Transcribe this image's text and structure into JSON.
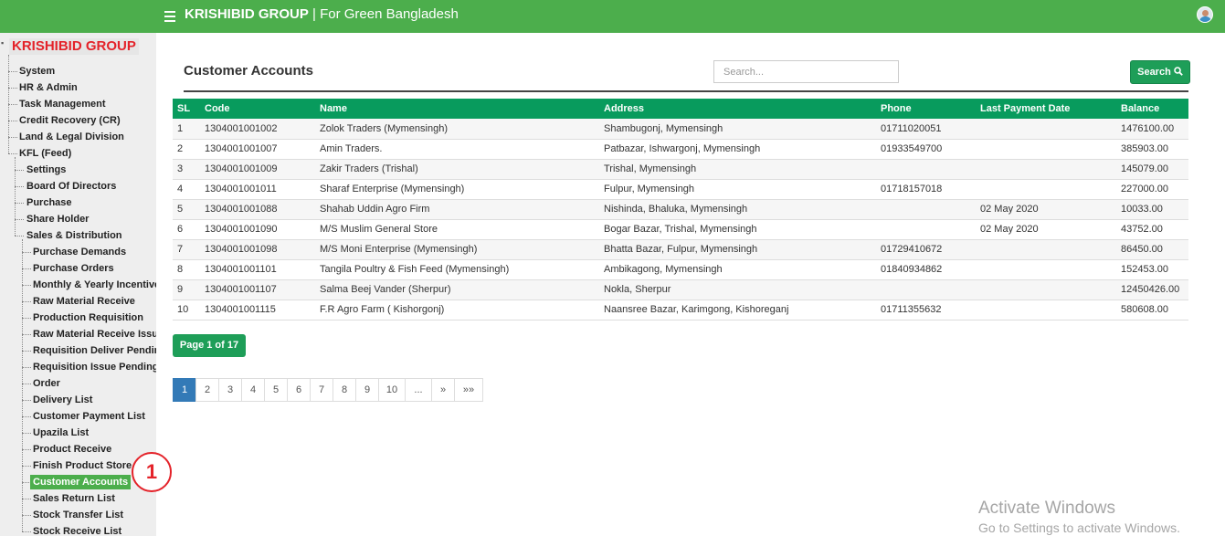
{
  "header": {
    "brand_strong": "KRISHIBID GROUP",
    "brand_rest": " | For Green Bangladesh"
  },
  "sidebar": {
    "root": "KRISHIBID GROUP",
    "top_items": [
      "System",
      "HR & Admin",
      "Task Management",
      "Credit Recovery (CR)",
      "Land & Legal Division",
      "KFL (Feed)"
    ],
    "kfl_children": [
      "Settings",
      "Board Of Directors",
      "Purchase",
      "Share Holder",
      "Sales & Distribution"
    ],
    "sales_children": [
      "Purchase Demands",
      "Purchase Orders",
      "Monthly & Yearly Incentive",
      "Raw Material Receive",
      "Production Requisition",
      "Raw Material Receive Issue",
      "Requisition Deliver Pending",
      "Requisition Issue Pending",
      "Order",
      "Delivery List",
      "Customer Payment List",
      "Upazila List",
      "Product Receive",
      "Finish Product Store",
      "Customer Accounts",
      "Sales Return List",
      "Stock Transfer List",
      "Stock Receive List"
    ],
    "active_item": "Customer Accounts"
  },
  "annotation": {
    "label": "1"
  },
  "main": {
    "title": "Customer Accounts",
    "search_placeholder": "Search...",
    "search_button": "Search"
  },
  "table": {
    "columns": [
      "SL",
      "Code",
      "Name",
      "Address",
      "Phone",
      "Last Payment Date",
      "Balance"
    ],
    "rows": [
      [
        "1",
        "1304001001002",
        "Zolok Traders (Mymensingh)",
        "Shambugonj, Mymensingh",
        "01711020051",
        "",
        "1476100.00"
      ],
      [
        "2",
        "1304001001007",
        "Amin Traders.",
        "Patbazar, Ishwargonj, Mymensingh",
        "01933549700",
        "",
        "385903.00"
      ],
      [
        "3",
        "1304001001009",
        "Zakir Traders (Trishal)",
        "Trishal, Mymensingh",
        "",
        "",
        "145079.00"
      ],
      [
        "4",
        "1304001001011",
        "Sharaf Enterprise (Mymensingh)",
        "Fulpur, Mymensingh",
        "01718157018",
        "",
        "227000.00"
      ],
      [
        "5",
        "1304001001088",
        "Shahab Uddin Agro Firm",
        "Nishinda, Bhaluka, Mymensingh",
        "",
        "02 May 2020",
        "10033.00"
      ],
      [
        "6",
        "1304001001090",
        "M/S Muslim General Store",
        "Bogar Bazar, Trishal, Mymensingh",
        "",
        "02 May 2020",
        "43752.00"
      ],
      [
        "7",
        "1304001001098",
        "M/S Moni Enterprise (Mymensingh)",
        "Bhatta Bazar, Fulpur, Mymensingh",
        "01729410672",
        "",
        "86450.00"
      ],
      [
        "8",
        "1304001001101",
        "Tangila Poultry & Fish Feed (Mymensingh)",
        "Ambikagong, Mymensingh",
        "01840934862",
        "",
        "152453.00"
      ],
      [
        "9",
        "1304001001107",
        "Salma Beej Vander (Sherpur)",
        "Nokla, Sherpur",
        "",
        "",
        "12450426.00"
      ],
      [
        "10",
        "1304001001115",
        "F.R Agro Farm ( Kishorgonj)",
        "Naansree Bazar, Karimgong, Kishoreganj",
        "01711355632",
        "",
        "580608.00"
      ]
    ]
  },
  "pagination": {
    "page_info": "Page 1 of 17",
    "pages": [
      "1",
      "2",
      "3",
      "4",
      "5",
      "6",
      "7",
      "8",
      "9",
      "10",
      "...",
      "»",
      "»»"
    ],
    "current": "1"
  },
  "watermark": {
    "line1": "Activate Windows",
    "line2": "Go to Settings to activate Windows."
  }
}
